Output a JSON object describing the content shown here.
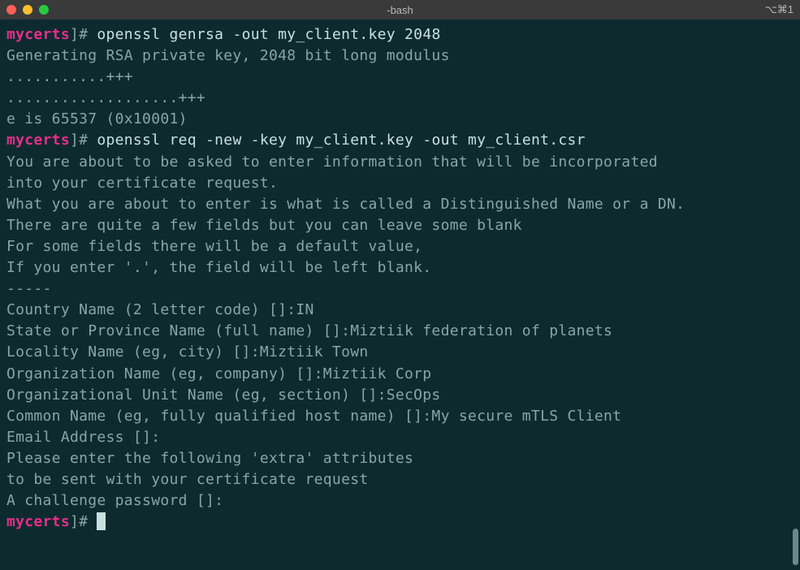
{
  "titlebar": {
    "title": "-bash",
    "right": "⌥⌘1"
  },
  "prompt": {
    "dir": "mycerts",
    "bracket": "]",
    "hash": "#"
  },
  "lines": {
    "cmd1": " openssl genrsa -out my_client.key 2048",
    "l1": "Generating RSA private key, 2048 bit long modulus",
    "l2": "...........+++",
    "l3": "...................+++",
    "l4": "e is 65537 (0x10001)",
    "cmd2": " openssl req -new -key my_client.key -out my_client.csr",
    "l5": "You are about to be asked to enter information that will be incorporated",
    "l6": "into your certificate request.",
    "l7": "What you are about to enter is what is called a Distinguished Name or a DN.",
    "l8": "There are quite a few fields but you can leave some blank",
    "l9": "For some fields there will be a default value,",
    "l10": "If you enter '.', the field will be left blank.",
    "l11": "-----",
    "l12": "Country Name (2 letter code) []:IN",
    "l13": "State or Province Name (full name) []:Miztiik federation of planets",
    "l14": "Locality Name (eg, city) []:Miztiik Town",
    "l15": "Organization Name (eg, company) []:Miztiik Corp",
    "l16": "Organizational Unit Name (eg, section) []:SecOps",
    "l17": "Common Name (eg, fully qualified host name) []:My secure mTLS Client",
    "l18": "Email Address []:",
    "l19": "",
    "l20": "Please enter the following 'extra' attributes",
    "l21": "to be sent with your certificate request",
    "l22": "A challenge password []:",
    "cmd3": " "
  }
}
